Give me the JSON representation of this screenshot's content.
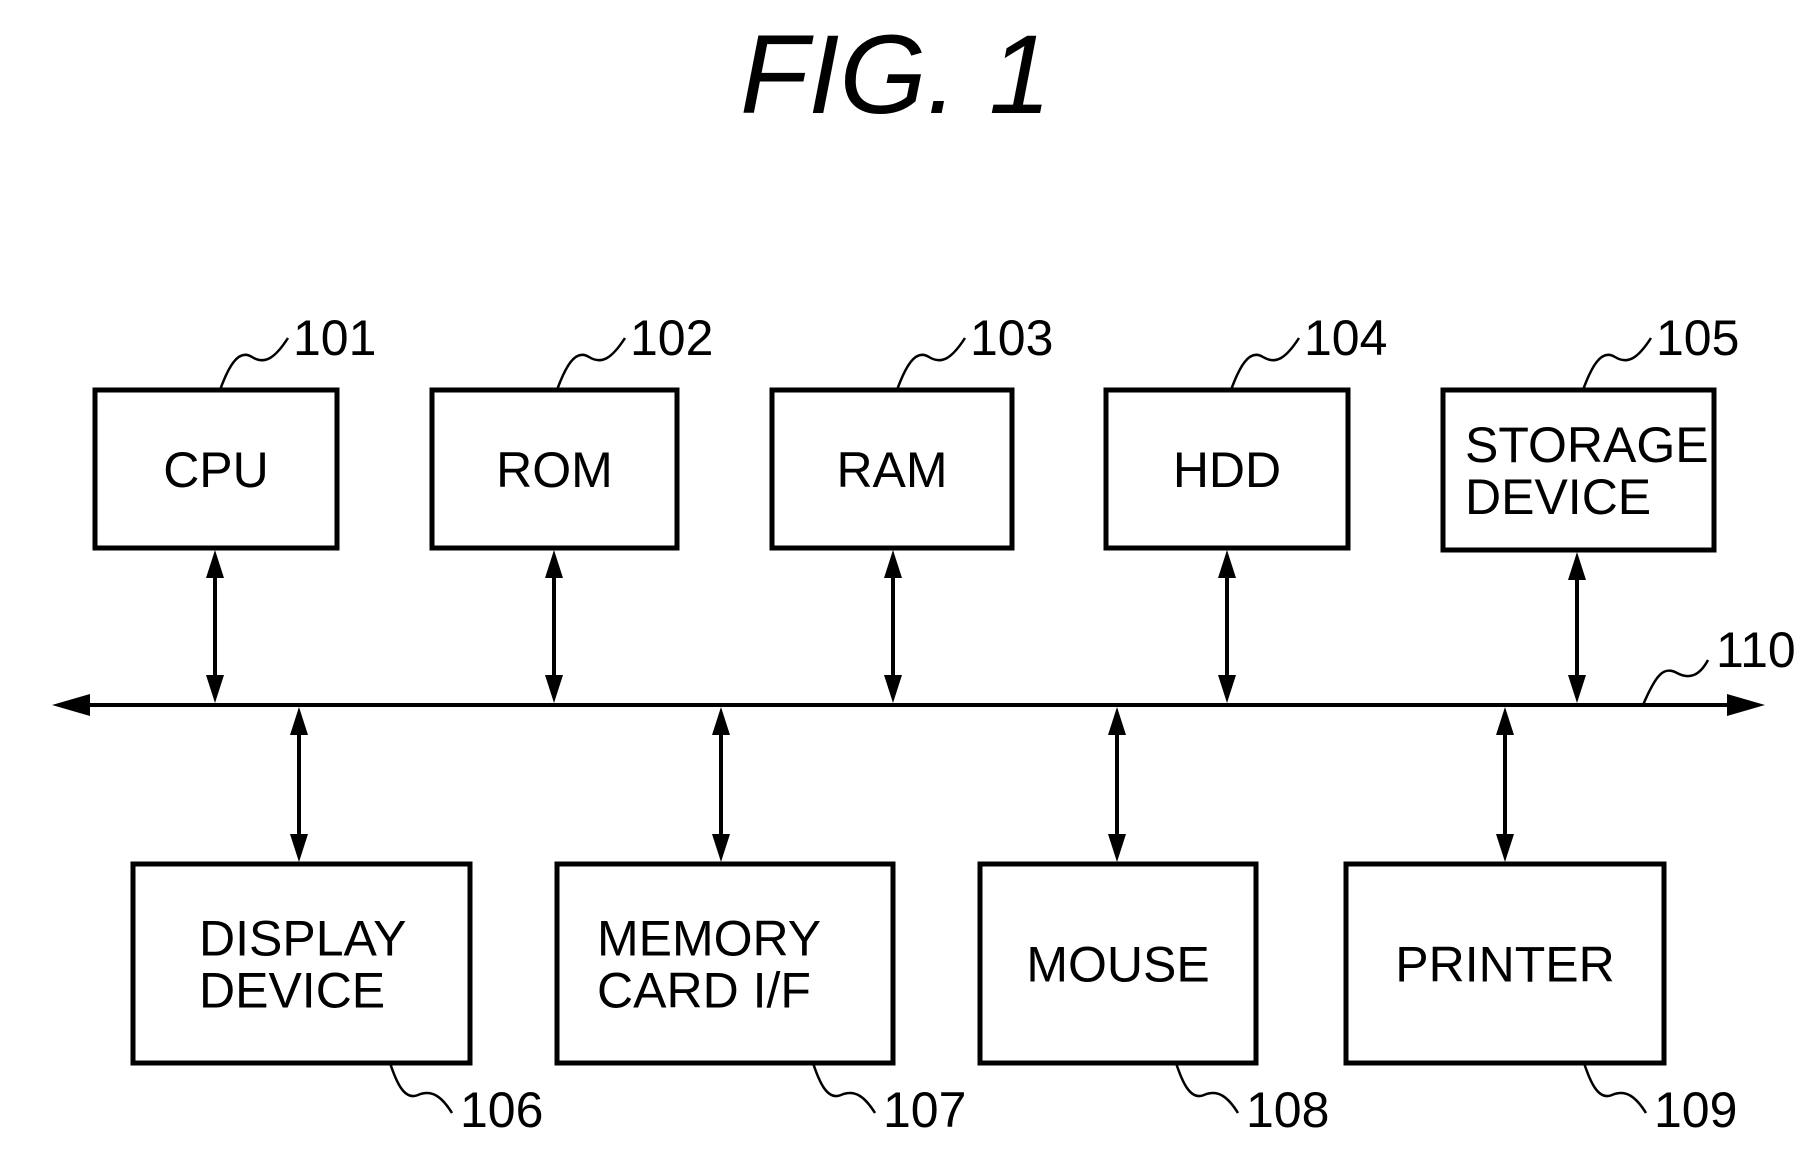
{
  "figure": {
    "title": "FIG. 1"
  },
  "bus": {
    "ref": "110",
    "direction": "bidirectional"
  },
  "top_row": [
    {
      "id": "cpu",
      "lines": [
        "CPU"
      ],
      "ref": "101"
    },
    {
      "id": "rom",
      "lines": [
        "ROM"
      ],
      "ref": "102"
    },
    {
      "id": "ram",
      "lines": [
        "RAM"
      ],
      "ref": "103"
    },
    {
      "id": "hdd",
      "lines": [
        "HDD"
      ],
      "ref": "104"
    },
    {
      "id": "storage",
      "lines": [
        "STORAGE",
        "DEVICE"
      ],
      "ref": "105"
    }
  ],
  "bottom_row": [
    {
      "id": "display",
      "lines": [
        "DISPLAY",
        "DEVICE"
      ],
      "ref": "106"
    },
    {
      "id": "memory-card",
      "lines": [
        "MEMORY",
        "CARD I/F"
      ],
      "ref": "107"
    },
    {
      "id": "mouse",
      "lines": [
        "MOUSE"
      ],
      "ref": "108"
    },
    {
      "id": "printer",
      "lines": [
        "PRINTER"
      ],
      "ref": "109"
    }
  ],
  "connections": "each block connected to bus 110 by a bidirectional arrow"
}
